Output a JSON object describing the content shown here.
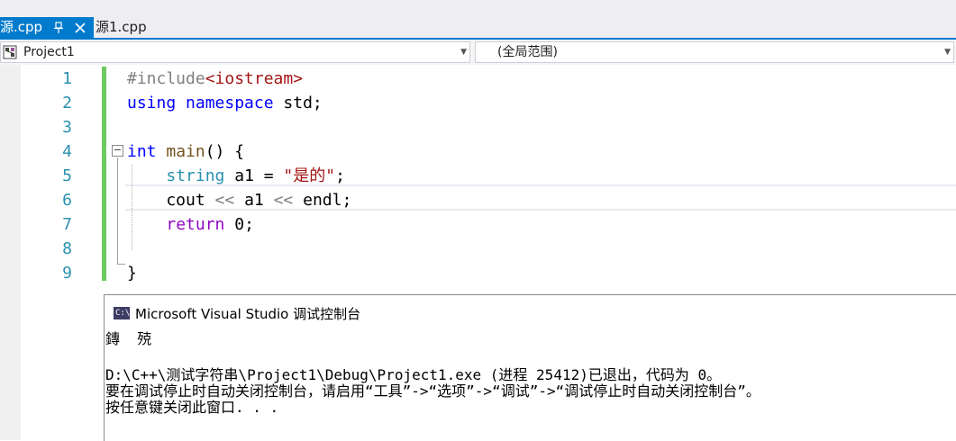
{
  "tabs": [
    {
      "label": "源.cpp",
      "active": true,
      "pin_glyph": "ᵖ",
      "close_glyph": "✕"
    },
    {
      "label": "源1.cpp",
      "active": false
    }
  ],
  "navbar": {
    "project": "Project1",
    "scope": "(全局范围)"
  },
  "editor": {
    "line_numbers": [
      "1",
      "2",
      "3",
      "4",
      "5",
      "6",
      "7",
      "8",
      "9"
    ],
    "lines": [
      [
        {
          "t": "#include",
          "c": "pp"
        },
        {
          "t": "<iostream>",
          "c": "str"
        }
      ],
      [
        {
          "t": "using",
          "c": "kw"
        },
        {
          "t": " ",
          "c": "plain"
        },
        {
          "t": "namespace",
          "c": "kw"
        },
        {
          "t": " std;",
          "c": "plain"
        }
      ],
      [],
      [
        {
          "t": "int",
          "c": "kw"
        },
        {
          "t": " ",
          "c": "plain"
        },
        {
          "t": "main",
          "c": "fn"
        },
        {
          "t": "() {",
          "c": "plain"
        }
      ],
      [
        {
          "t": "    ",
          "c": "plain"
        },
        {
          "t": "string",
          "c": "ty"
        },
        {
          "t": " a1 = ",
          "c": "plain"
        },
        {
          "t": "\"是的\"",
          "c": "str"
        },
        {
          "t": ";",
          "c": "plain"
        }
      ],
      [
        {
          "t": "    cout ",
          "c": "plain"
        },
        {
          "t": "<<",
          "c": "op"
        },
        {
          "t": " a1 ",
          "c": "plain"
        },
        {
          "t": "<<",
          "c": "op"
        },
        {
          "t": " endl;",
          "c": "plain"
        }
      ],
      [
        {
          "t": "    ",
          "c": "plain"
        },
        {
          "t": "return",
          "c": "ret"
        },
        {
          "t": " 0;",
          "c": "plain"
        }
      ],
      [],
      [
        {
          "t": "}",
          "c": "plain"
        }
      ]
    ]
  },
  "console": {
    "title": "Microsoft Visual Studio 调试控制台",
    "icon_text": "C:\\",
    "output": [
      "鏄  殑",
      "",
      "D:\\C++\\测试字符串\\Project1\\Debug\\Project1.exe (进程 25412)已退出，代码为 0。",
      "要在调试停止时自动关闭控制台，请启用“工具”->“选项”->“调试”->“调试停止时自动关闭控制台”。",
      "按任意键关闭此窗口. . ."
    ]
  },
  "colors": {
    "accent": "#007acc",
    "line_number": "#2b91af",
    "keyword": "#0000ff",
    "string": "#a31515",
    "change_bar": "#6bcb5f"
  }
}
